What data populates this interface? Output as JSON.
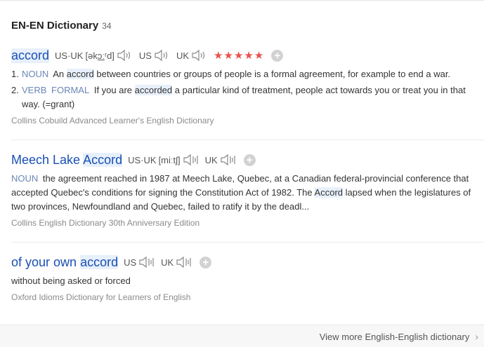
{
  "header": {
    "title": "EN-EN Dictionary",
    "count": "34"
  },
  "entries": [
    {
      "headword": "accord",
      "pron_label": "US·UK",
      "ipa_pre": "[ək",
      "ipa_ul": "ɔː",
      "ipa_post": "ʳd]",
      "us_label": "US",
      "uk_label": "UK",
      "rating": "★★★★★",
      "add": "+",
      "senses": [
        {
          "num": "1.",
          "pos": "NOUN",
          "pre": "An",
          "hl": "accord",
          "post": "between countries or groups of people is a formal agreement, for example to end a war."
        },
        {
          "num": "2.",
          "pos": "VERB",
          "grammar": "FORMAL",
          "pre": "If you are",
          "hl": "accorded",
          "post": "a particular kind of treatment, people act towards you or treat you in that way. (=grant)"
        }
      ],
      "source": "Collins Cobuild Advanced Learner's English Dictionary"
    },
    {
      "headword_pre": "Meech Lake",
      "headword_hl": "Accord",
      "pron_label": "US·UK",
      "ipa": "[miːtʃ]",
      "uk_label": "UK",
      "add": "+",
      "pos": "NOUN",
      "pre": "the agreement reached in 1987 at Meech Lake, Quebec, at a Canadian federal-provincial conference that accepted Quebec's conditions for signing the Constitution Act of 1982. The",
      "hl": "Accord",
      "post": "lapsed when the legislatures of two provinces, Newfoundland and Quebec, failed to ratify it by the deadl...",
      "source": "Collins English Dictionary 30th Anniversary Edition"
    },
    {
      "headword_pre": "of your own",
      "headword_hl": "accord",
      "us_label": "US",
      "uk_label": "UK",
      "add": "+",
      "definition": "without being asked or forced",
      "source": "Oxford Idioms Dictionary for Learners of English"
    }
  ],
  "footer": {
    "more": "View more English-English dictionary",
    "chevron": "›"
  },
  "colors": {
    "link": "#1a4fb4",
    "highlight": "#e7f0fb",
    "star": "#e8524b",
    "pos": "#6b87b6"
  },
  "icons": [
    "speaker-icon",
    "audio-wave-icon",
    "plus-icon",
    "chevron-right-icon"
  ]
}
